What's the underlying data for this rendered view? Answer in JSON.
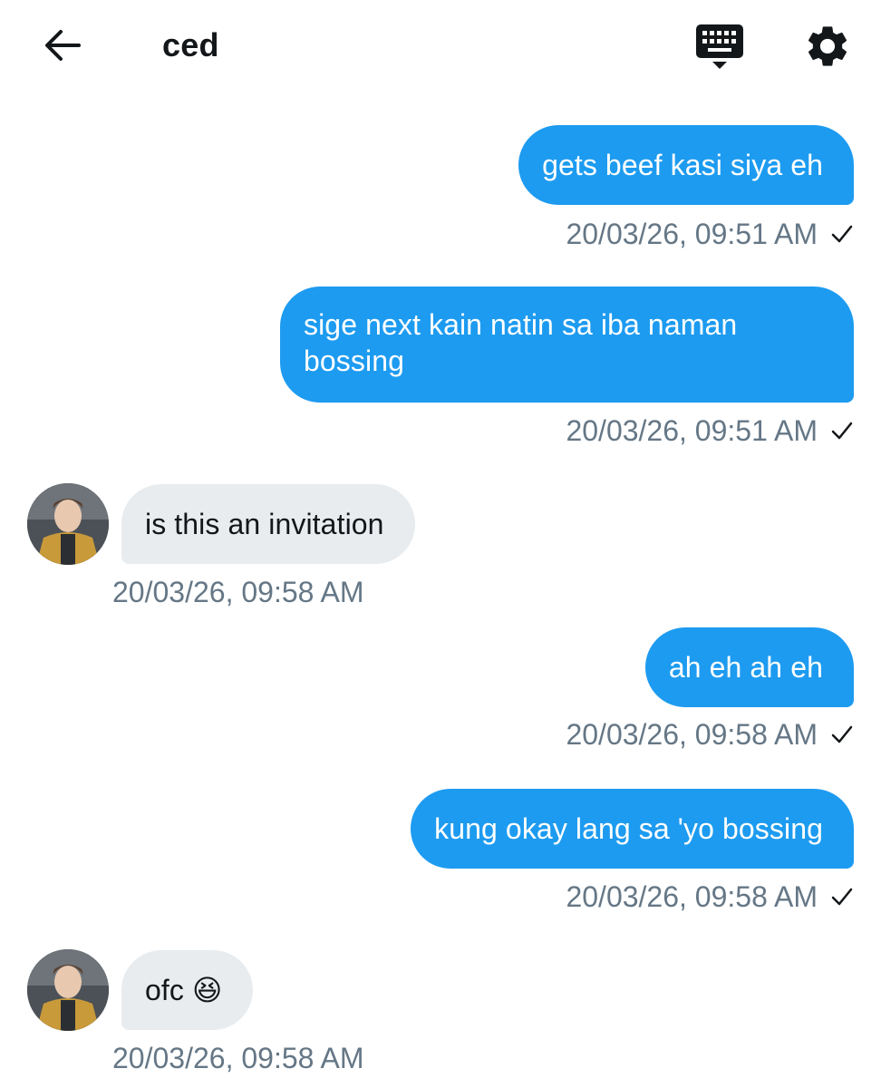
{
  "header": {
    "title": "ced"
  },
  "messages": [
    {
      "direction": "out",
      "text": "gets beef kasi siya eh",
      "timestamp": "20/03/26, 09:51 AM"
    },
    {
      "direction": "out",
      "text": "sige next kain natin sa iba naman bossing",
      "timestamp": "20/03/26, 09:51 AM"
    },
    {
      "direction": "in",
      "text": "is this an invitation",
      "timestamp": "20/03/26, 09:58 AM"
    },
    {
      "direction": "out",
      "text": "ah eh ah eh",
      "timestamp": "20/03/26, 09:58 AM"
    },
    {
      "direction": "out",
      "text": "kung okay lang sa 'yo bossing",
      "timestamp": "20/03/26, 09:58 AM"
    },
    {
      "direction": "in",
      "text": "ofc 😆",
      "timestamp": "20/03/26, 09:58 AM"
    }
  ],
  "icons": {
    "back": "arrow-left-icon",
    "keyboard": "keyboard-icon",
    "settings": "gear-icon",
    "read_receipt": "check-icon"
  },
  "colors": {
    "outgoing_bubble": "#1d9bf0",
    "incoming_bubble": "#e8ecef",
    "timestamp": "#657786"
  }
}
